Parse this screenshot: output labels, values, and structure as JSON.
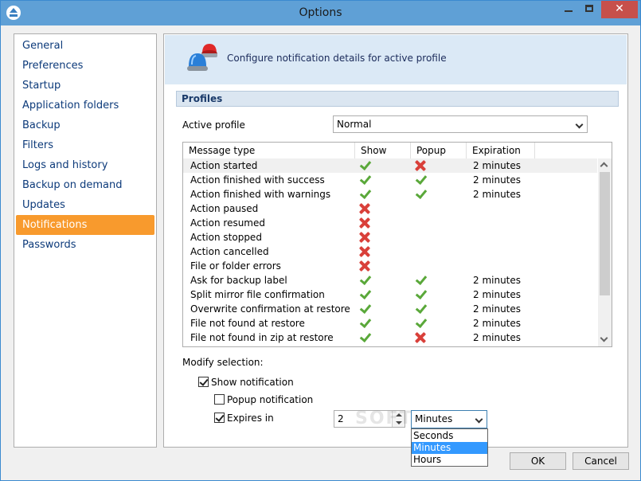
{
  "window": {
    "title": "Options"
  },
  "nav": {
    "items": [
      {
        "label": "General"
      },
      {
        "label": "Preferences"
      },
      {
        "label": "Startup"
      },
      {
        "label": "Application folders"
      },
      {
        "label": "Backup"
      },
      {
        "label": "Filters"
      },
      {
        "label": "Logs and history"
      },
      {
        "label": "Backup on demand"
      },
      {
        "label": "Updates"
      },
      {
        "label": "Notifications"
      },
      {
        "label": "Passwords"
      }
    ],
    "active": "Notifications"
  },
  "header": {
    "text": "Configure notification details for active profile",
    "icon": "siren-icon"
  },
  "profiles": {
    "section_title": "Profiles",
    "active_profile_label": "Active profile",
    "active_profile_value": "Normal"
  },
  "table": {
    "columns": [
      "Message type",
      "Show",
      "Popup",
      "Expiration"
    ],
    "rows": [
      {
        "type": "Action started",
        "show": true,
        "popup": false,
        "expiration": "2 minutes"
      },
      {
        "type": "Action finished with success",
        "show": true,
        "popup": true,
        "expiration": "2 minutes"
      },
      {
        "type": "Action finished with warnings",
        "show": true,
        "popup": true,
        "expiration": "2 minutes"
      },
      {
        "type": "Action paused",
        "show": false,
        "popup": null,
        "expiration": ""
      },
      {
        "type": "Action resumed",
        "show": false,
        "popup": null,
        "expiration": ""
      },
      {
        "type": "Action stopped",
        "show": false,
        "popup": null,
        "expiration": ""
      },
      {
        "type": "Action cancelled",
        "show": false,
        "popup": null,
        "expiration": ""
      },
      {
        "type": "File or folder errors",
        "show": false,
        "popup": null,
        "expiration": ""
      },
      {
        "type": "Ask for backup label",
        "show": true,
        "popup": true,
        "expiration": "2 minutes"
      },
      {
        "type": "Split mirror file confirmation",
        "show": true,
        "popup": true,
        "expiration": "2 minutes"
      },
      {
        "type": "Overwrite confirmation at restore",
        "show": true,
        "popup": true,
        "expiration": "2 minutes"
      },
      {
        "type": "File not found at restore",
        "show": true,
        "popup": true,
        "expiration": "2 minutes"
      },
      {
        "type": "File not found in zip at restore",
        "show": true,
        "popup": false,
        "expiration": "2 minutes"
      }
    ],
    "selected_row": "Action started"
  },
  "modify": {
    "label": "Modify selection:",
    "show_notification": {
      "label": "Show notification",
      "checked": true
    },
    "popup_notification": {
      "label": "Popup notification",
      "checked": false
    },
    "expires_in": {
      "label": "Expires in",
      "checked": true,
      "value": "2"
    },
    "unit": {
      "value": "Minutes",
      "options": [
        "Seconds",
        "Minutes",
        "Hours"
      ],
      "highlighted": "Minutes"
    }
  },
  "buttons": {
    "ok": "OK",
    "cancel": "Cancel"
  },
  "watermark": "SOFTPEDIA",
  "colors": {
    "accent": "#f89a2d",
    "titlebar": "#5fa0d6",
    "check": "#5aa83a",
    "cross": "#d9403a",
    "highlight": "#3399ff"
  }
}
